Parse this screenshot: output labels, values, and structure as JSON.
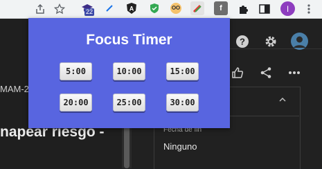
{
  "toolbar": {
    "extension_badge": "22",
    "profile_initial": "I"
  },
  "page": {
    "left_code_snippet": "MAM-2",
    "left_heading_snippet": "napear riesgo -",
    "field_label": "Fecha de fin",
    "field_value": "Ninguno"
  },
  "popup": {
    "title": "Focus Timer",
    "timers": [
      "5:00",
      "10:00",
      "15:00",
      "20:00",
      "25:00",
      "30:00"
    ]
  },
  "colors": {
    "popup_bg": "#5865e0",
    "page_bg": "#212121",
    "toolbar_bg": "#f1f3f4"
  }
}
